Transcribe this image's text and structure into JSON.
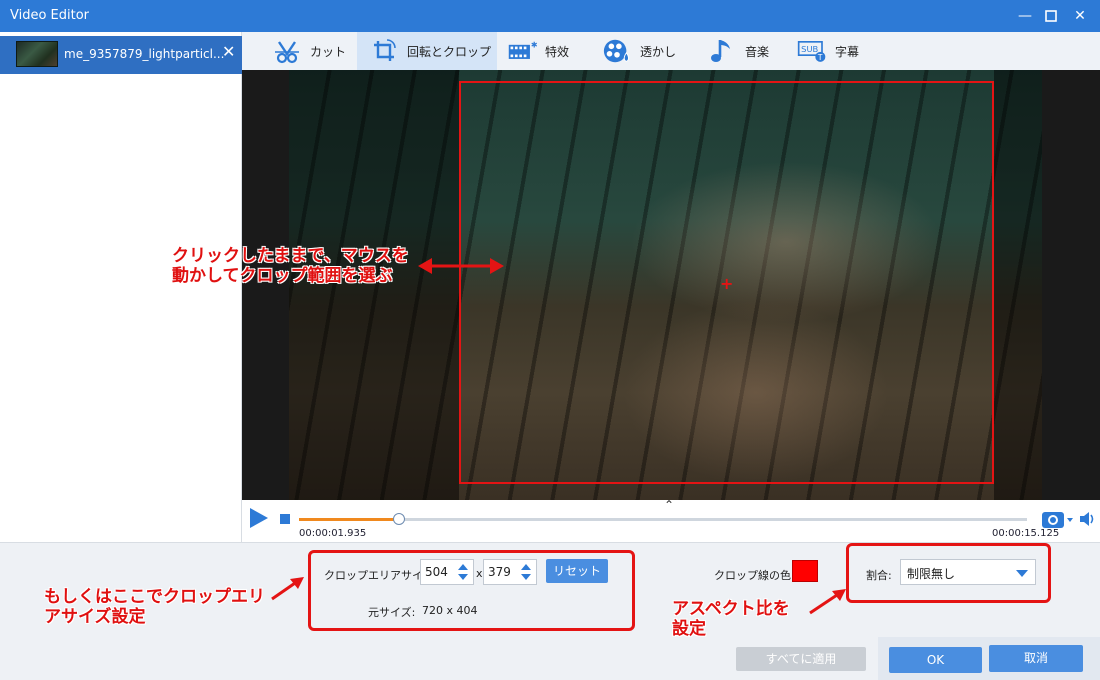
{
  "window": {
    "title": "Video Editor"
  },
  "sidebar": {
    "file_name": "me_9357879_lightparticl..."
  },
  "toolbar": {
    "tabs": [
      {
        "label": "カット",
        "icon": "cut-icon"
      },
      {
        "label": "回転とクロップ",
        "icon": "crop-icon",
        "active": true
      },
      {
        "label": "特效",
        "icon": "effects-icon"
      },
      {
        "label": "透かし",
        "icon": "watermark-icon"
      },
      {
        "label": "音楽",
        "icon": "music-icon"
      },
      {
        "label": "字幕",
        "icon": "subtitle-icon",
        "badge": "SUB"
      }
    ]
  },
  "preview": {
    "annotation_drag": "クリックしたままで、マウスを\n動かしてクロップ範囲を選ぶ"
  },
  "playback": {
    "current_time": "00:00:01.935",
    "end_time": "00:00:15.125",
    "progress": 0.137
  },
  "crop": {
    "area_label": "クロップエリアサイズ:",
    "width": "504",
    "separator": "x",
    "height": "379",
    "reset_label": "リセット",
    "original_size_label": "元サイズ:",
    "original_size": "720 x 404",
    "line_color_label": "クロップ線の色:",
    "line_color": "#ff0000",
    "ratio_label": "割合:",
    "ratio_value": "制限無し"
  },
  "annotations": {
    "area_hint": "もしくはここでクロップエリ\nアサイズ設定",
    "ratio_hint": "アスペクト比を\n設定"
  },
  "buttons": {
    "apply_all": "すべてに適用",
    "ok": "OK",
    "cancel": "取消"
  },
  "colors": {
    "accent": "#2d7ad6",
    "highlight": "#e41414"
  }
}
